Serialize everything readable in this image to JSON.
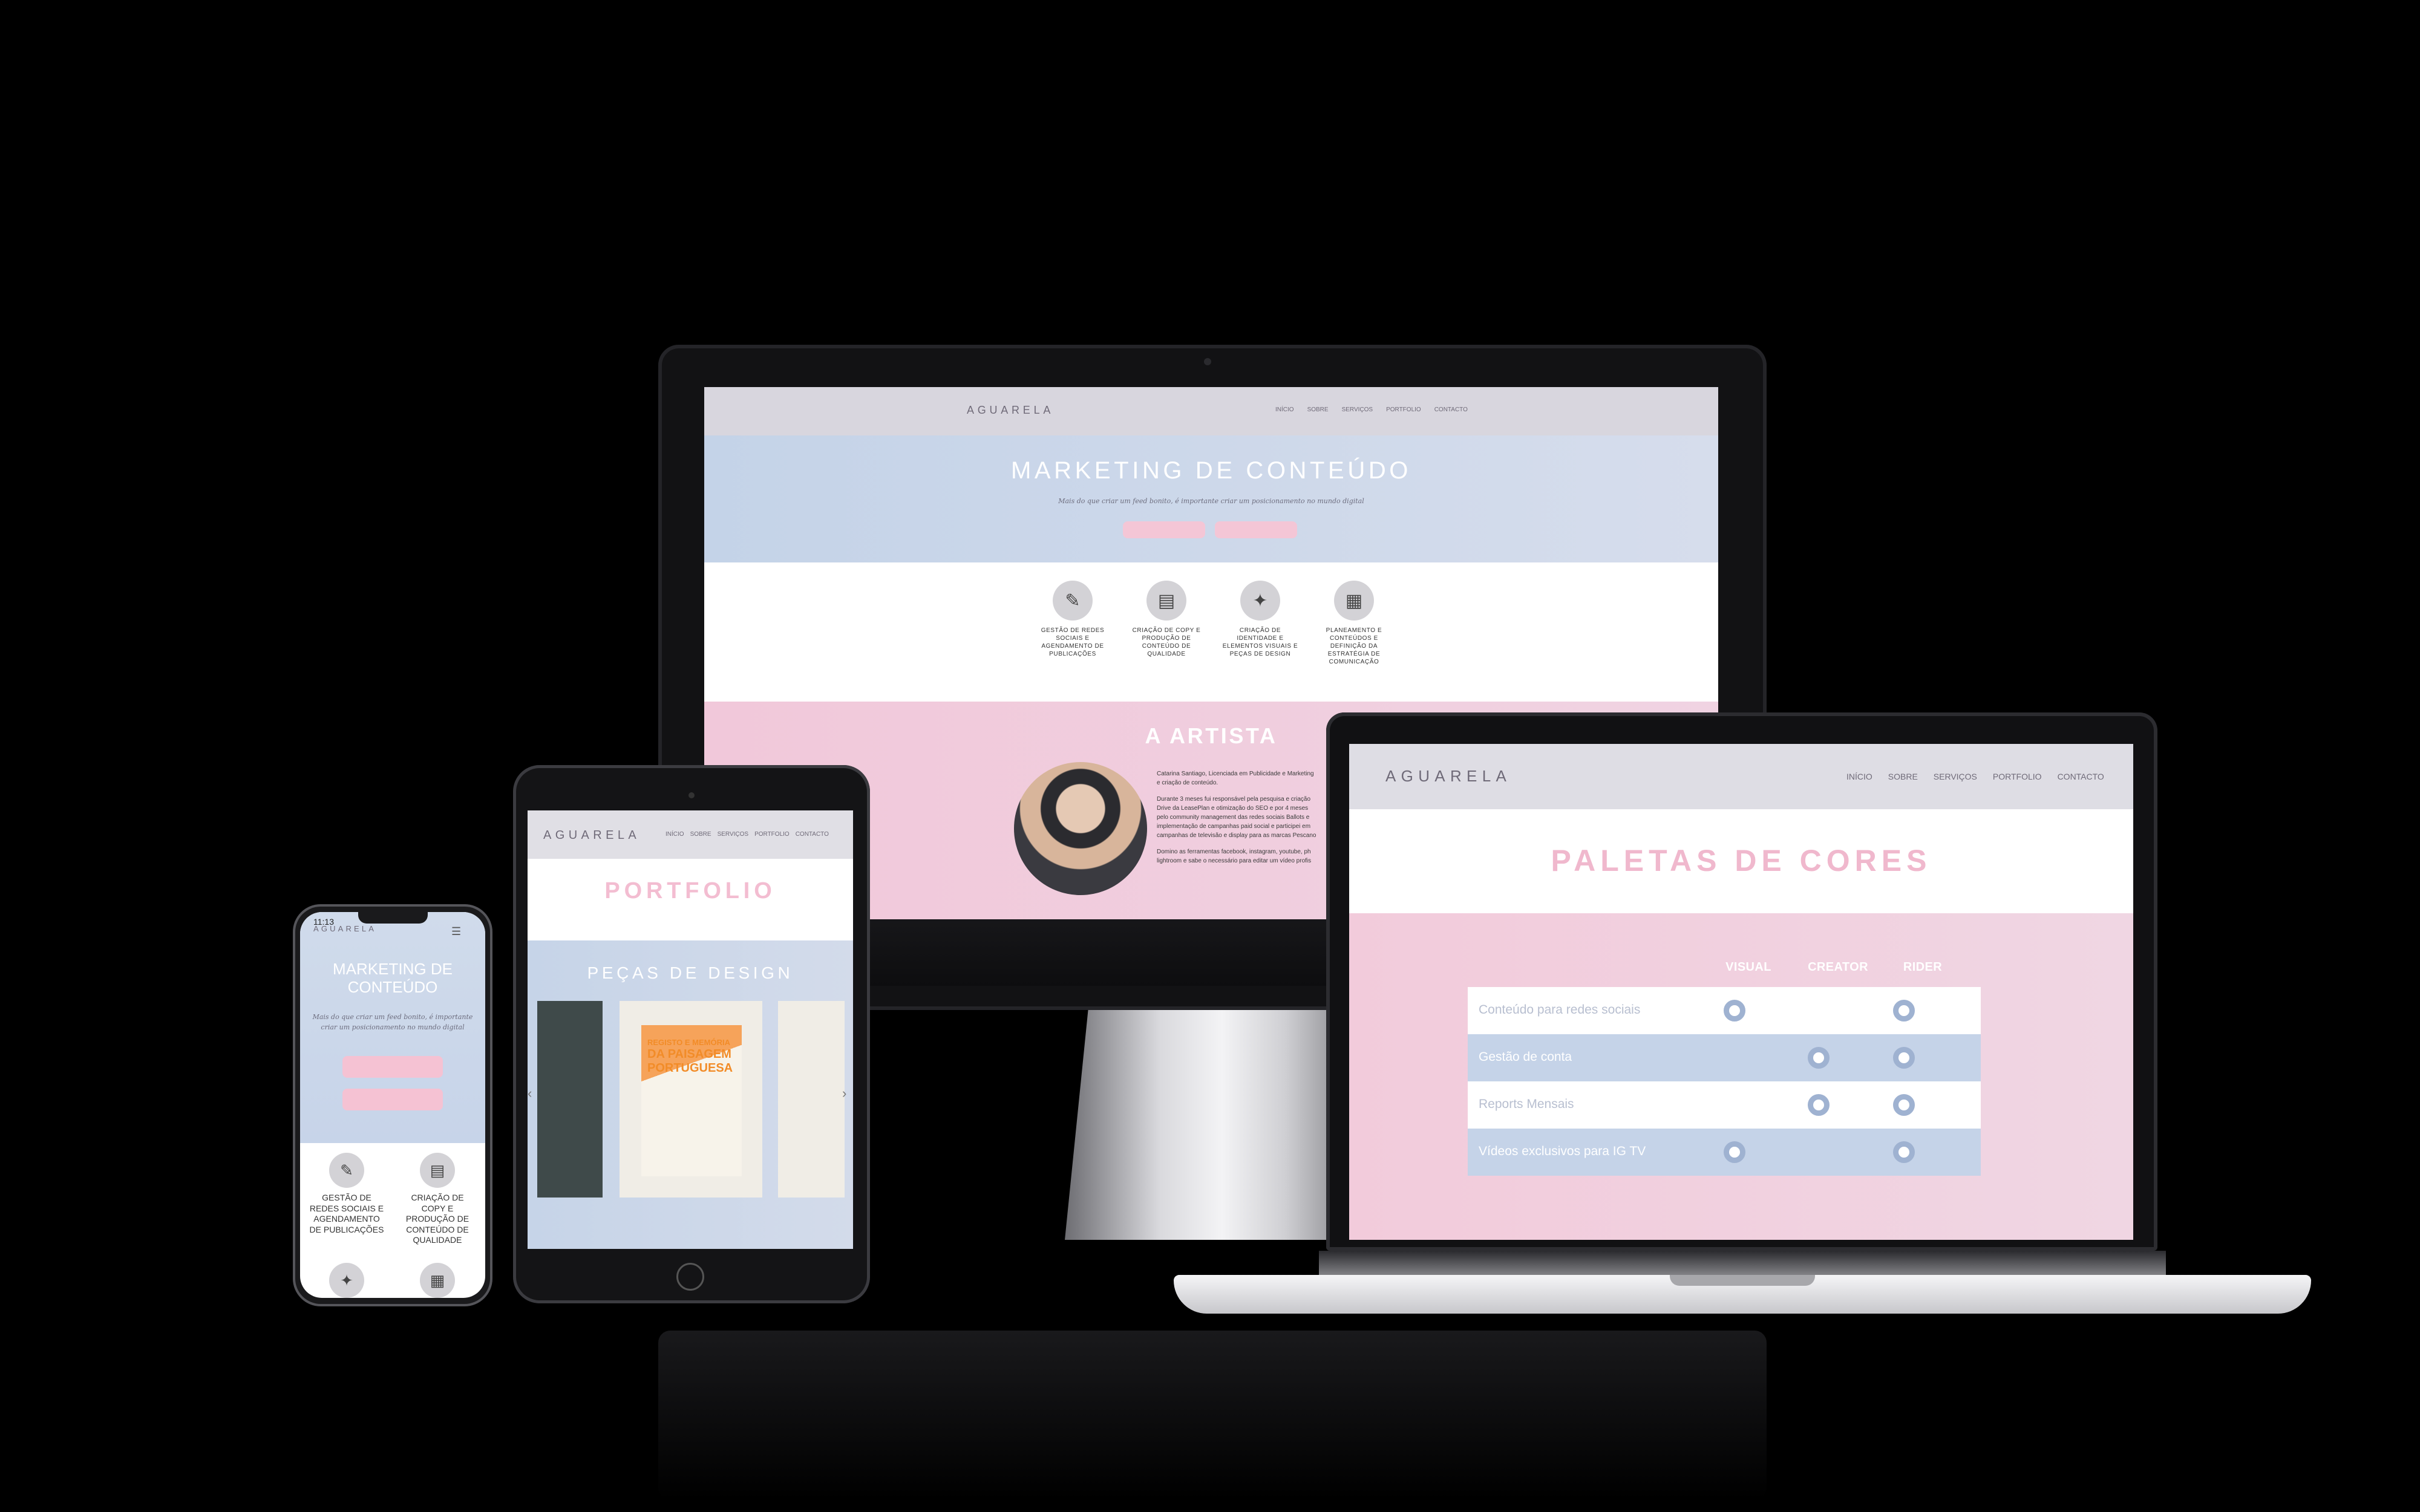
{
  "imac": {
    "brand": "AGUARELA",
    "nav": [
      "INÍCIO",
      "SOBRE",
      "SERVIÇOS",
      "PORTFOLIO",
      "CONTACTO"
    ],
    "hero_title": "MARKETING DE CONTEÚDO",
    "hero_subtitle": "Mais do que criar um feed bonito, é importante criar um posicionamento no mundo digital",
    "buttons": [
      "",
      ""
    ],
    "services": [
      {
        "icon": "pencil-icon",
        "glyph": "✎",
        "text": "GESTÃO DE REDES SOCIAIS E AGENDAMENTO DE PUBLICAÇÕES"
      },
      {
        "icon": "document-icon",
        "glyph": "▤",
        "text": "CRIAÇÃO DE COPY E PRODUÇÃO DE CONTEÚDO DE QUALIDADE"
      },
      {
        "icon": "lightbulb-icon",
        "glyph": "✦",
        "text": "CRIAÇÃO DE IDENTIDADE E ELEMENTOS VISUAIS E PEÇAS DE DESIGN"
      },
      {
        "icon": "calendar-icon",
        "glyph": "▦",
        "text": "PLANEAMENTO E CONTEÚDOS E DEFINIÇÃO DA ESTRATÉGIA DE COMUNICAÇÃO"
      }
    ],
    "artist_title": "A ARTISTA",
    "bio": [
      "Catarina Santiago, Licenciada em Publicidade e Marketing",
      "e criação de conteúdo.",
      "Durante 3 meses fui responsável pela pesquisa e criação",
      "Drive da LeasePlan e otimização do SEO e por 4 meses",
      "pelo community management das redes sociais Ballots e",
      "implementação de campanhas paid social e participei em",
      "campanhas de televisão e display para as marcas Pescano",
      "Domino as ferramentas facebook, instagram, youtube, ph",
      "lightroom e sabe o necessário para editar um vídeo profis"
    ]
  },
  "laptop": {
    "brand": "AGUARELA",
    "nav": [
      "INÍCIO",
      "SOBRE",
      "SERVIÇOS",
      "PORTFOLIO",
      "CONTACTO"
    ],
    "title": "PALETAS DE CORES",
    "columns": [
      "VISUAL",
      "CREATOR",
      "RIDER"
    ],
    "rows": [
      {
        "label": "Conteúdo para redes sociais",
        "checks": [
          true,
          false,
          true
        ]
      },
      {
        "label": "Gestão de conta",
        "checks": [
          false,
          true,
          true
        ]
      },
      {
        "label": "Reports Mensais",
        "checks": [
          false,
          true,
          true
        ]
      },
      {
        "label": "Vídeos exclusivos para IG TV",
        "checks": [
          true,
          false,
          true
        ]
      }
    ],
    "row_colors": [
      "#ffffff",
      "#c5d3e8",
      "#ffffff",
      "#c5d3e8"
    ],
    "label_colors": [
      "#b8bfd0",
      "#ffffff",
      "#b8bfd0",
      "#ffffff"
    ]
  },
  "tablet": {
    "brand": "AGUARELA",
    "nav": [
      "INÍCIO",
      "SOBRE",
      "SERVIÇOS",
      "PORTFOLIO",
      "CONTACTO"
    ],
    "title": "PORTFOLIO",
    "subtitle": "PEÇAS DE DESIGN",
    "poster_lines": [
      "REGISTO E MEMÓRIA",
      "DA PAISAGEM",
      "PORTUGUESA"
    ]
  },
  "phone": {
    "time": "11:13",
    "brand": "AGUARELA",
    "title": "MARKETING DE CONTEÚDO",
    "subtitle": "Mais do que criar um feed bonito, é importante criar um posicionamento no mundo digital",
    "buttons": [
      "",
      ""
    ],
    "services": [
      {
        "icon": "pencil-icon",
        "glyph": "✎",
        "text": "GESTÃO DE REDES SOCIAIS E AGENDAMENTO DE PUBLICAÇÕES"
      },
      {
        "icon": "document-icon",
        "glyph": "▤",
        "text": "CRIAÇÃO DE COPY E PRODUÇÃO DE CONTEÚDO DE QUALIDADE"
      },
      {
        "icon": "lightbulb-icon",
        "glyph": "✦",
        "text": ""
      },
      {
        "icon": "calendar-icon",
        "glyph": "▦",
        "text": ""
      }
    ]
  }
}
